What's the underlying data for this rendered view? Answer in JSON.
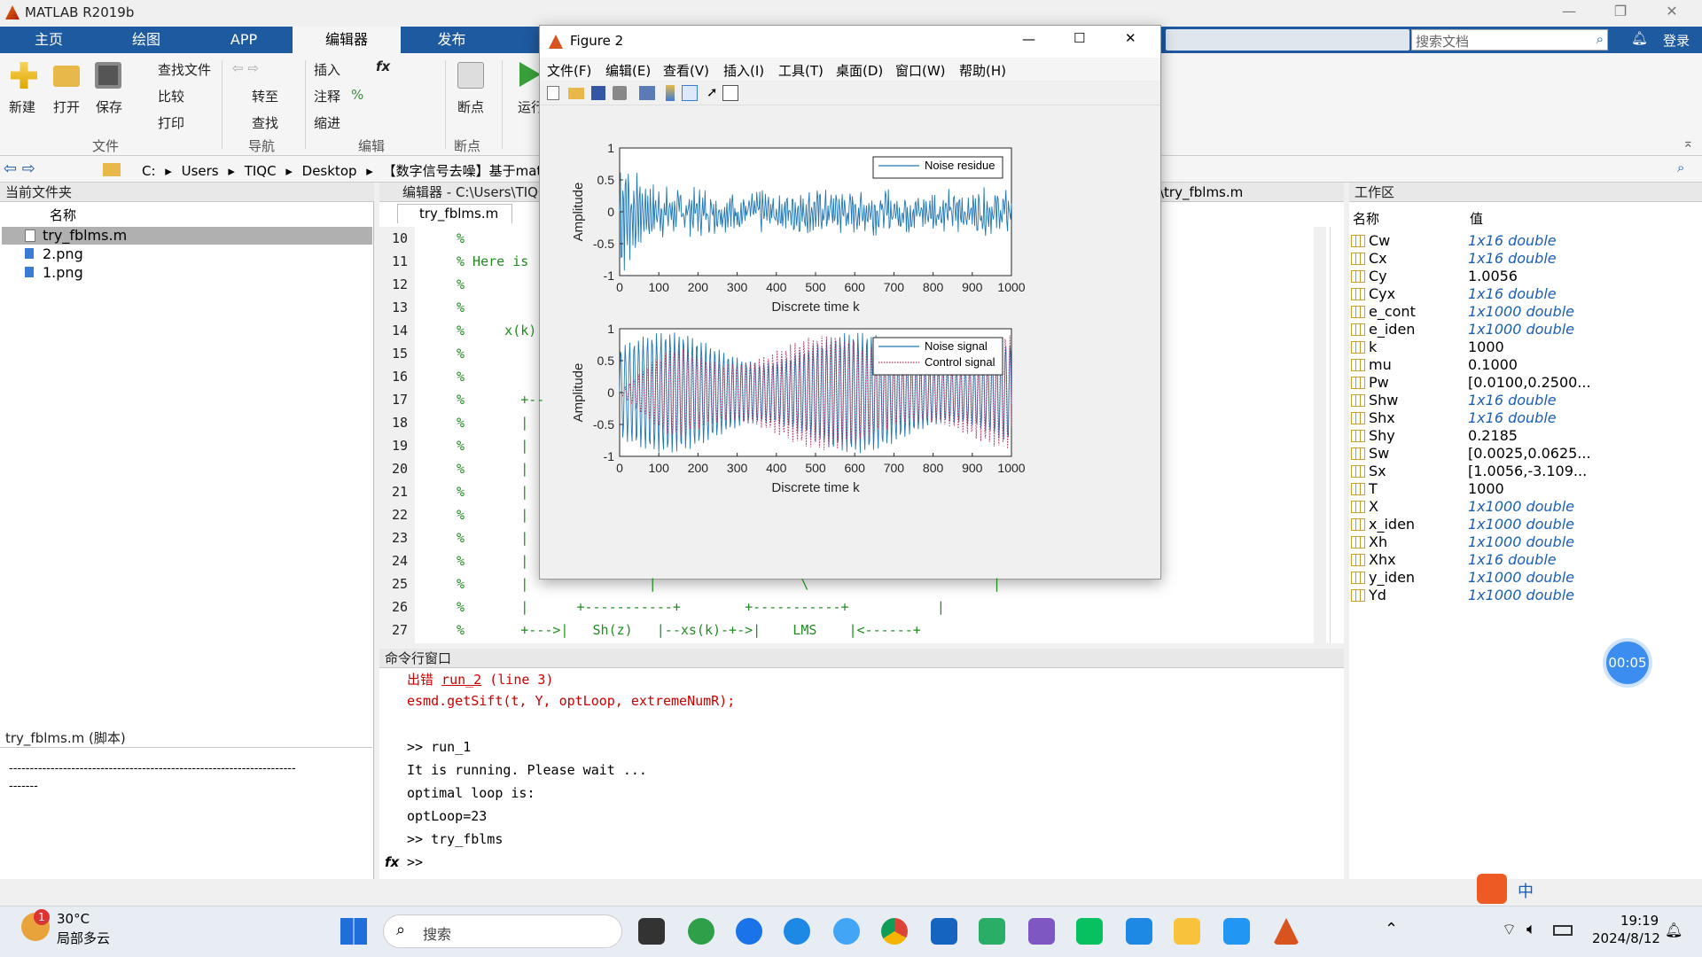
{
  "app": {
    "title": "MATLAB R2019b"
  },
  "tabs": [
    "主页",
    "绘图",
    "APP",
    "编辑器",
    "发布"
  ],
  "ribbon": {
    "new": "新建",
    "open": "打开",
    "save": "保存",
    "find_files": "查找文件",
    "compare": "比较",
    "print": "打印",
    "goto": "转至",
    "find": "查找",
    "insert": "插入",
    "comment": "注释",
    "indent": "缩进",
    "breakpoints": "断点",
    "run": "运行",
    "sec_file": "文件",
    "sec_nav": "导航",
    "sec_edit": "编辑",
    "sec_bp": "断点"
  },
  "search_placeholder": "搜索文档",
  "login": "登录",
  "address": [
    "C:",
    "Users",
    "TIQC",
    "Desktop",
    "【数字信号去噪】基于matlab"
  ],
  "current_folder": {
    "title": "当前文件夹",
    "col_name": "名称",
    "files": [
      "try_fblms.m",
      "2.png",
      "1.png"
    ],
    "detail_title": "try_fblms.m  (脚本)",
    "detail_text": "---------------------------------------------------------------------",
    "detail_text2": "-------"
  },
  "editor": {
    "title": "编辑器 - C:\\Users\\TIQC",
    "tab": "try_fblms.m",
    "right_title": "\\try_fblms.m",
    "lines": [
      {
        "n": "10",
        "t": "%"
      },
      {
        "n": "11",
        "t": "% Here is"
      },
      {
        "n": "12",
        "t": "%"
      },
      {
        "n": "13",
        "t": "%"
      },
      {
        "n": "14",
        "t": "%     x(k)"
      },
      {
        "n": "15",
        "t": "%"
      },
      {
        "n": "16",
        "t": "%"
      },
      {
        "n": "17",
        "t": "%       +--"
      },
      {
        "n": "18",
        "t": "%       |"
      },
      {
        "n": "19",
        "t": "%       |"
      },
      {
        "n": "20",
        "t": "%       |"
      },
      {
        "n": "21",
        "t": "%       |"
      },
      {
        "n": "22",
        "t": "%       |"
      },
      {
        "n": "23",
        "t": "%       |"
      },
      {
        "n": "24",
        "t": "%       |"
      },
      {
        "n": "25",
        "t": "%       |               |                  \\                       |"
      },
      {
        "n": "26",
        "t": "%       |      +-----------+        +-----------+           |"
      },
      {
        "n": "27",
        "t": "%       +--->|   Sh(z)   |--xs(k)-+->|    LMS    |<------+"
      }
    ]
  },
  "command": {
    "title": "命令行窗口",
    "err_word": "出错",
    "err_fn": "run_2",
    "err_line": "(line 3)",
    "err_code": "esmd.getSift(t, Y, optLoop, extremeNumR);",
    "lines": [
      ">> run_1",
      "It is running. Please wait ...",
      "optimal loop is:",
      "optLoop=23",
      ">> try_fblms"
    ],
    "prompt": ">>"
  },
  "workspace": {
    "title": "工作区",
    "col_name": "名称",
    "col_value": "值",
    "vars": [
      {
        "name": "Cw",
        "value": "1x16 double",
        "italic": true
      },
      {
        "name": "Cx",
        "value": "1x16 double",
        "italic": true
      },
      {
        "name": "Cy",
        "value": "1.0056",
        "italic": false
      },
      {
        "name": "Cyx",
        "value": "1x16 double",
        "italic": true
      },
      {
        "name": "e_cont",
        "value": "1x1000 double",
        "italic": true
      },
      {
        "name": "e_iden",
        "value": "1x1000 double",
        "italic": true
      },
      {
        "name": "k",
        "value": "1000",
        "italic": false
      },
      {
        "name": "mu",
        "value": "0.1000",
        "italic": false
      },
      {
        "name": "Pw",
        "value": "[0.0100,0.2500...",
        "italic": false
      },
      {
        "name": "Shw",
        "value": "1x16 double",
        "italic": true
      },
      {
        "name": "Shx",
        "value": "1x16 double",
        "italic": true
      },
      {
        "name": "Shy",
        "value": "0.2185",
        "italic": false
      },
      {
        "name": "Sw",
        "value": "[0.0025,0.0625...",
        "italic": false
      },
      {
        "name": "Sx",
        "value": "[1.0056,-3.109...",
        "italic": false
      },
      {
        "name": "T",
        "value": "1000",
        "italic": false
      },
      {
        "name": "X",
        "value": "1x1000 double",
        "italic": true
      },
      {
        "name": "x_iden",
        "value": "1x1000 double",
        "italic": true
      },
      {
        "name": "Xh",
        "value": "1x1000 double",
        "italic": true
      },
      {
        "name": "Xhx",
        "value": "1x16 double",
        "italic": true
      },
      {
        "name": "y_iden",
        "value": "1x1000 double",
        "italic": true
      },
      {
        "name": "Yd",
        "value": "1x1000 double",
        "italic": true
      }
    ]
  },
  "timer": "00:05",
  "figure": {
    "title": "Figure 2",
    "menu": [
      "文件(F)",
      "编辑(E)",
      "查看(V)",
      "插入(I)",
      "工具(T)",
      "桌面(D)",
      "窗口(W)",
      "帮助(H)"
    ]
  },
  "chart_data": [
    {
      "type": "line",
      "xlabel": "Discrete time k",
      "ylabel": "Amplitude",
      "xlim": [
        0,
        1000
      ],
      "ylim": [
        -1,
        1
      ],
      "xticks": [
        "0",
        "100",
        "200",
        "300",
        "400",
        "500",
        "600",
        "700",
        "800",
        "900",
        "1000"
      ],
      "yticks": [
        "1",
        "0.5",
        "0",
        "-0.5",
        "-1"
      ],
      "legend": "top-right",
      "series": [
        {
          "name": "Noise residue",
          "color": "#1f77b4",
          "style": "solid",
          "pattern": "decaying_noise",
          "initial_amp": 0.95,
          "steady_amp": 0.3
        }
      ]
    },
    {
      "type": "line",
      "xlabel": "Discrete time k",
      "ylabel": "Amplitude",
      "xlim": [
        0,
        1000
      ],
      "ylim": [
        -1,
        1
      ],
      "xticks": [
        "0",
        "100",
        "200",
        "300",
        "400",
        "500",
        "600",
        "700",
        "800",
        "900",
        "1000"
      ],
      "yticks": [
        "1",
        "0.5",
        "0",
        "-0.5",
        "-1"
      ],
      "legend": "top-right",
      "series": [
        {
          "name": "Noise signal",
          "color": "#1f77b4",
          "style": "solid",
          "pattern": "oscillation",
          "amp": 0.95
        },
        {
          "name": "Control signal",
          "color": "#b03060",
          "style": "dotted",
          "pattern": "growing_oscillation",
          "amp": 0.9
        }
      ]
    }
  ],
  "status": {
    "weather_temp": "30°C",
    "weather_desc": "局部多云",
    "badge": "1",
    "search": "搜索",
    "time": "19:19",
    "date": "2024/8/12",
    "ime": "中"
  }
}
